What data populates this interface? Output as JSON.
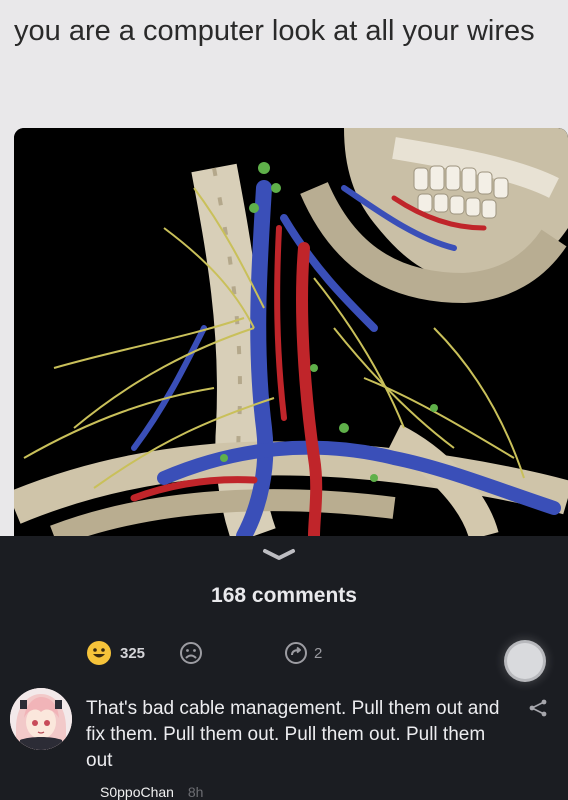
{
  "post": {
    "title": "you are a computer look at all your wires",
    "image_icon": "anatomy-neck-illustration"
  },
  "comments": {
    "count_label": "168 comments"
  },
  "reactions": {
    "laugh_count": "325",
    "share_count": "2"
  },
  "comment": {
    "text": "That's bad cable management. Pull them out and fix them. Pull them out. Pull them out. Pull them out",
    "username": "S0ppoChan",
    "time": "8h"
  },
  "colors": {
    "post_bg": "#e9e8ea",
    "dark_bg": "#1b1d22",
    "emoji_yellow": "#f6c33a"
  }
}
